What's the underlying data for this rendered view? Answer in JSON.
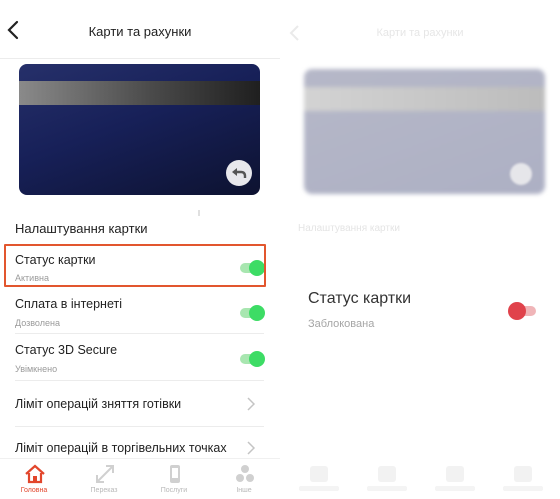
{
  "left": {
    "header": {
      "title": "Карти та рахунки"
    },
    "section_title": "Налаштування картки",
    "rows": [
      {
        "title": "Статус картки",
        "subtitle": "Активна"
      },
      {
        "title": "Сплата в інтернеті",
        "subtitle": "Дозволена"
      },
      {
        "title": "Статус 3D Secure",
        "subtitle": "Увімкнено"
      },
      {
        "title": "Ліміт операцій зняття готівки"
      },
      {
        "title": "Ліміт операцій в торгівельних точках"
      }
    ],
    "tabs": [
      {
        "label": "Головна",
        "icon": "home-icon",
        "active": true
      },
      {
        "label": "Переказ",
        "icon": "transfer-icon"
      },
      {
        "label": "Послуги",
        "icon": "phone-icon"
      },
      {
        "label": "Інше",
        "icon": "more-icon"
      }
    ]
  },
  "right": {
    "header": {
      "title": "Карти та рахунки"
    },
    "section_title": "Налаштування картки",
    "status": {
      "title": "Статус картки",
      "subtitle": "Заблокована"
    }
  },
  "colors": {
    "accent": "#e2462c",
    "toggle_on": "#3ddc65",
    "toggle_off": "#e0424b",
    "card": "#172058"
  }
}
